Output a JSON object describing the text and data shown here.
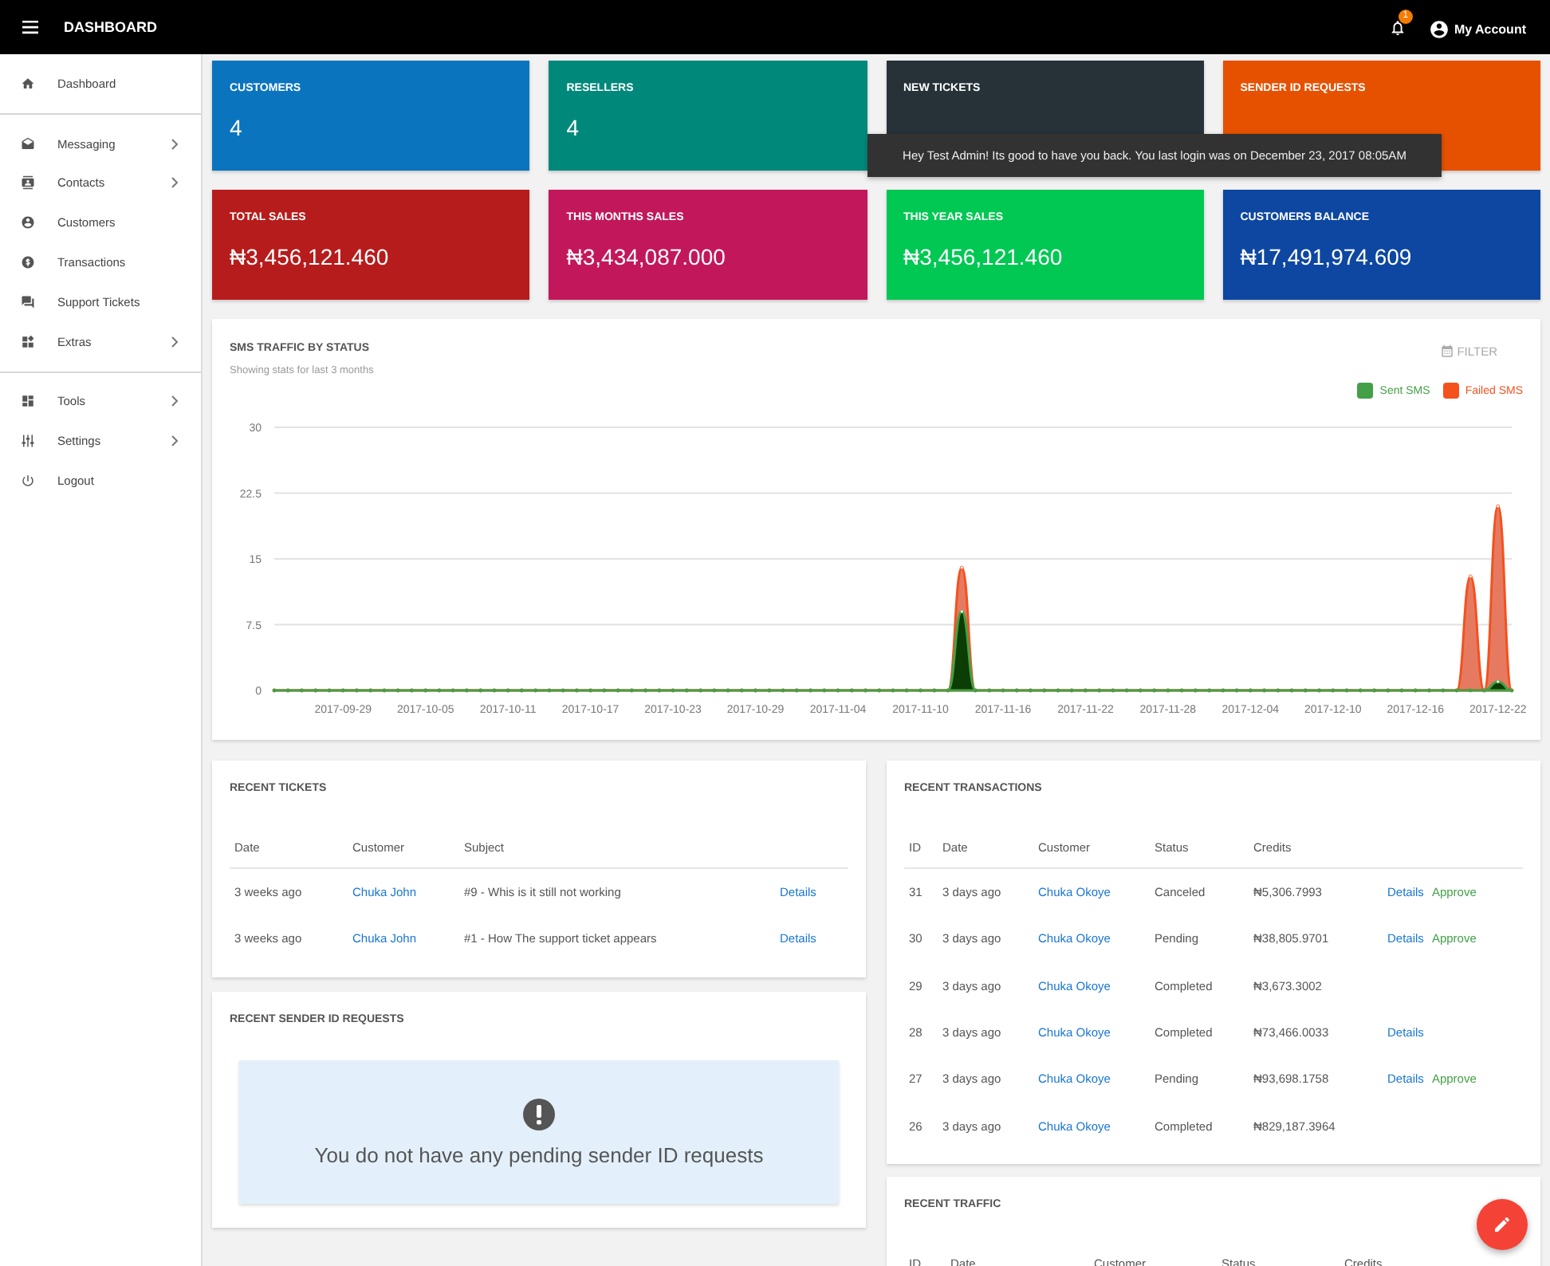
{
  "topbar": {
    "title": "DASHBOARD",
    "notification_count": "1",
    "account_label": "My Account"
  },
  "sidebar": {
    "sections": [
      [
        {
          "label": "Dashboard",
          "kind": "home",
          "has_submenu": false
        }
      ],
      [
        {
          "label": "Messaging",
          "kind": "envelope",
          "has_submenu": true
        },
        {
          "label": "Contacts",
          "kind": "contacts",
          "has_submenu": true
        },
        {
          "label": "Customers",
          "kind": "person",
          "has_submenu": false
        },
        {
          "label": "Transactions",
          "kind": "dollar",
          "has_submenu": false
        },
        {
          "label": "Support Tickets",
          "kind": "chat",
          "has_submenu": false
        },
        {
          "label": "Extras",
          "kind": "widgets",
          "has_submenu": true
        }
      ],
      [
        {
          "label": "Tools",
          "kind": "tiles",
          "has_submenu": true
        },
        {
          "label": "Settings",
          "kind": "sliders",
          "has_submenu": true
        },
        {
          "label": "Logout",
          "kind": "power",
          "has_submenu": false
        }
      ]
    ]
  },
  "stats": [
    {
      "label": "CUSTOMERS",
      "value": "4",
      "color": "#0a74bf"
    },
    {
      "label": "RESELLERS",
      "value": "4",
      "color": "#00897b"
    },
    {
      "label": "NEW TICKETS",
      "color": "#263238"
    },
    {
      "label": "SENDER ID REQUESTS",
      "color": "#e65100"
    },
    {
      "label": "TOTAL SALES",
      "value": "₦3,456,121.460",
      "color": "#b71c1c"
    },
    {
      "label": "THIS MONTHS SALES",
      "value": "₦3,434,087.000",
      "color": "#c2185b"
    },
    {
      "label": "THIS YEAR SALES",
      "value": "₦3,456,121.460",
      "color": "#00c853"
    },
    {
      "label": "CUSTOMERS BALANCE",
      "value": "₦17,491,974.609",
      "color": "#0d47a1"
    }
  ],
  "tooltip": {
    "text": "Hey Test Admin! Its good to have you back. You last login was on December 23, 2017 08:05AM"
  },
  "sms_traffic": {
    "title": "SMS TRAFFIC BY STATUS",
    "subtitle": "Showing stats for last 3 months",
    "filter_label": "FILTER",
    "chart_data": {
      "type": "area",
      "stacked": false,
      "categories": [
        null,
        null,
        null,
        null,
        null,
        "2017-09-29",
        null,
        null,
        null,
        null,
        null,
        "2017-10-05",
        null,
        null,
        null,
        null,
        null,
        "2017-10-11",
        null,
        null,
        null,
        null,
        null,
        "2017-10-17",
        null,
        null,
        null,
        null,
        null,
        "2017-10-23",
        null,
        null,
        null,
        null,
        null,
        "2017-10-29",
        null,
        null,
        null,
        null,
        null,
        "2017-11-04",
        null,
        null,
        null,
        null,
        null,
        "2017-11-10",
        null,
        null,
        null,
        null,
        null,
        "2017-11-16",
        null,
        null,
        null,
        null,
        null,
        "2017-11-22",
        null,
        null,
        null,
        null,
        null,
        "2017-11-28",
        null,
        null,
        null,
        null,
        null,
        "2017-12-04",
        null,
        null,
        null,
        null,
        null,
        "2017-12-10",
        null,
        null,
        null,
        null,
        null,
        "2017-12-16",
        null,
        null,
        null,
        null,
        null,
        "2017-12-22",
        null
      ],
      "series": [
        {
          "name": "Sent SMS",
          "color": "#43a047",
          "values": [
            0,
            0,
            0,
            0,
            0,
            0,
            0,
            0,
            0,
            0,
            0,
            0,
            0,
            0,
            0,
            0,
            0,
            0,
            0,
            0,
            0,
            0,
            0,
            0,
            0,
            0,
            0,
            0,
            0,
            0,
            0,
            0,
            0,
            0,
            0,
            0,
            0,
            0,
            0,
            0,
            0,
            0,
            0,
            0,
            0,
            0,
            0,
            0,
            0,
            0,
            9,
            0,
            0,
            0,
            0,
            0,
            0,
            0,
            0,
            0,
            0,
            0,
            0,
            0,
            0,
            0,
            0,
            0,
            0,
            0,
            0,
            0,
            0,
            0,
            0,
            0,
            0,
            0,
            0,
            0,
            0,
            0,
            0,
            0,
            0,
            0,
            0,
            0,
            0,
            1,
            0
          ]
        },
        {
          "name": "Failed SMS",
          "color": "#f4511e",
          "values": [
            0,
            0,
            0,
            0,
            0,
            0,
            0,
            0,
            0,
            0,
            0,
            0,
            0,
            0,
            0,
            0,
            0,
            0,
            0,
            0,
            0,
            0,
            0,
            0,
            0,
            0,
            0,
            0,
            0,
            0,
            0,
            0,
            0,
            0,
            0,
            0,
            0,
            0,
            0,
            0,
            0,
            0,
            0,
            0,
            0,
            0,
            0,
            0,
            0,
            0,
            14,
            0,
            0,
            0,
            0,
            0,
            0,
            0,
            0,
            0,
            0,
            0,
            0,
            0,
            0,
            0,
            0,
            0,
            0,
            0,
            0,
            0,
            0,
            0,
            0,
            0,
            0,
            0,
            0,
            0,
            0,
            0,
            0,
            0,
            0,
            0,
            0,
            13,
            0,
            21,
            0
          ]
        }
      ],
      "ylim": [
        0,
        30
      ],
      "yticks": [
        {
          "value": 0,
          "label": "0"
        },
        {
          "value": 7.5,
          "label": "7.5"
        },
        {
          "value": 15,
          "label": "15"
        },
        {
          "value": 22.5,
          "label": "22.5"
        },
        {
          "value": 30,
          "label": "30"
        }
      ],
      "grid": true
    }
  },
  "recent_tickets": {
    "title": "RECENT TICKETS",
    "columns": [
      "Date",
      "Customer",
      "Subject"
    ],
    "rows": [
      {
        "date": "3 weeks ago",
        "customer": "Chuka John",
        "subject": "#9 - Whis is it still not working",
        "action": "Details"
      },
      {
        "date": "3 weeks ago",
        "customer": "Chuka John",
        "subject": "#1 - How The support ticket appears",
        "action": "Details"
      }
    ]
  },
  "recent_sender_id_requests": {
    "title": "RECENT SENDER ID REQUESTS",
    "empty_message": "You do not have any pending sender ID requests"
  },
  "recent_transactions": {
    "title": "RECENT TRANSACTIONS",
    "columns": [
      "ID",
      "Date",
      "Customer",
      "Status",
      "Credits"
    ],
    "rows": [
      {
        "id": "31",
        "date": "3 days ago",
        "customer": "Chuka Okoye",
        "status": "Canceled",
        "credits": "₦5,306.7993",
        "actions": [
          {
            "label": "Details",
            "kind": "details"
          },
          {
            "label": "Approve",
            "kind": "approve"
          }
        ]
      },
      {
        "id": "30",
        "date": "3 days ago",
        "customer": "Chuka Okoye",
        "status": "Pending",
        "credits": "₦38,805.9701",
        "actions": [
          {
            "label": "Details",
            "kind": "details"
          },
          {
            "label": "Approve",
            "kind": "approve"
          }
        ]
      },
      {
        "id": "29",
        "date": "3 days ago",
        "customer": "Chuka Okoye",
        "status": "Completed",
        "credits": "₦3,673.3002"
      },
      {
        "id": "28",
        "date": "3 days ago",
        "customer": "Chuka Okoye",
        "status": "Completed",
        "credits": "₦73,466.0033",
        "actions": [
          {
            "label": "Details",
            "kind": "details"
          }
        ]
      },
      {
        "id": "27",
        "date": "3 days ago",
        "customer": "Chuka Okoye",
        "status": "Pending",
        "credits": "₦93,698.1758",
        "actions": [
          {
            "label": "Details",
            "kind": "details"
          },
          {
            "label": "Approve",
            "kind": "approve"
          }
        ]
      },
      {
        "id": "26",
        "date": "3 days ago",
        "customer": "Chuka Okoye",
        "status": "Completed",
        "credits": "₦829,187.3964"
      }
    ]
  },
  "recent_traffic": {
    "title": "RECENT TRAFFIC",
    "columns": [
      "ID",
      "Date",
      "Customer",
      "Status",
      "Credits"
    ]
  }
}
